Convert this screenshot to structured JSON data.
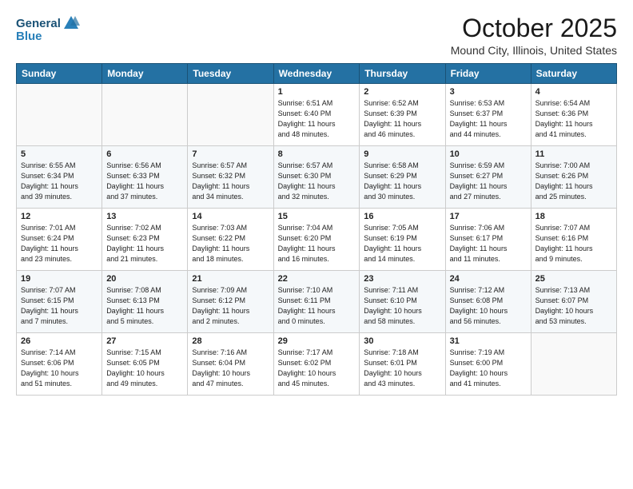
{
  "header": {
    "logo_general": "General",
    "logo_blue": "Blue",
    "month": "October 2025",
    "location": "Mound City, Illinois, United States"
  },
  "weekdays": [
    "Sunday",
    "Monday",
    "Tuesday",
    "Wednesday",
    "Thursday",
    "Friday",
    "Saturday"
  ],
  "weeks": [
    [
      {
        "day": "",
        "info": ""
      },
      {
        "day": "",
        "info": ""
      },
      {
        "day": "",
        "info": ""
      },
      {
        "day": "1",
        "info": "Sunrise: 6:51 AM\nSunset: 6:40 PM\nDaylight: 11 hours\nand 48 minutes."
      },
      {
        "day": "2",
        "info": "Sunrise: 6:52 AM\nSunset: 6:39 PM\nDaylight: 11 hours\nand 46 minutes."
      },
      {
        "day": "3",
        "info": "Sunrise: 6:53 AM\nSunset: 6:37 PM\nDaylight: 11 hours\nand 44 minutes."
      },
      {
        "day": "4",
        "info": "Sunrise: 6:54 AM\nSunset: 6:36 PM\nDaylight: 11 hours\nand 41 minutes."
      }
    ],
    [
      {
        "day": "5",
        "info": "Sunrise: 6:55 AM\nSunset: 6:34 PM\nDaylight: 11 hours\nand 39 minutes."
      },
      {
        "day": "6",
        "info": "Sunrise: 6:56 AM\nSunset: 6:33 PM\nDaylight: 11 hours\nand 37 minutes."
      },
      {
        "day": "7",
        "info": "Sunrise: 6:57 AM\nSunset: 6:32 PM\nDaylight: 11 hours\nand 34 minutes."
      },
      {
        "day": "8",
        "info": "Sunrise: 6:57 AM\nSunset: 6:30 PM\nDaylight: 11 hours\nand 32 minutes."
      },
      {
        "day": "9",
        "info": "Sunrise: 6:58 AM\nSunset: 6:29 PM\nDaylight: 11 hours\nand 30 minutes."
      },
      {
        "day": "10",
        "info": "Sunrise: 6:59 AM\nSunset: 6:27 PM\nDaylight: 11 hours\nand 27 minutes."
      },
      {
        "day": "11",
        "info": "Sunrise: 7:00 AM\nSunset: 6:26 PM\nDaylight: 11 hours\nand 25 minutes."
      }
    ],
    [
      {
        "day": "12",
        "info": "Sunrise: 7:01 AM\nSunset: 6:24 PM\nDaylight: 11 hours\nand 23 minutes."
      },
      {
        "day": "13",
        "info": "Sunrise: 7:02 AM\nSunset: 6:23 PM\nDaylight: 11 hours\nand 21 minutes."
      },
      {
        "day": "14",
        "info": "Sunrise: 7:03 AM\nSunset: 6:22 PM\nDaylight: 11 hours\nand 18 minutes."
      },
      {
        "day": "15",
        "info": "Sunrise: 7:04 AM\nSunset: 6:20 PM\nDaylight: 11 hours\nand 16 minutes."
      },
      {
        "day": "16",
        "info": "Sunrise: 7:05 AM\nSunset: 6:19 PM\nDaylight: 11 hours\nand 14 minutes."
      },
      {
        "day": "17",
        "info": "Sunrise: 7:06 AM\nSunset: 6:17 PM\nDaylight: 11 hours\nand 11 minutes."
      },
      {
        "day": "18",
        "info": "Sunrise: 7:07 AM\nSunset: 6:16 PM\nDaylight: 11 hours\nand 9 minutes."
      }
    ],
    [
      {
        "day": "19",
        "info": "Sunrise: 7:07 AM\nSunset: 6:15 PM\nDaylight: 11 hours\nand 7 minutes."
      },
      {
        "day": "20",
        "info": "Sunrise: 7:08 AM\nSunset: 6:13 PM\nDaylight: 11 hours\nand 5 minutes."
      },
      {
        "day": "21",
        "info": "Sunrise: 7:09 AM\nSunset: 6:12 PM\nDaylight: 11 hours\nand 2 minutes."
      },
      {
        "day": "22",
        "info": "Sunrise: 7:10 AM\nSunset: 6:11 PM\nDaylight: 11 hours\nand 0 minutes."
      },
      {
        "day": "23",
        "info": "Sunrise: 7:11 AM\nSunset: 6:10 PM\nDaylight: 10 hours\nand 58 minutes."
      },
      {
        "day": "24",
        "info": "Sunrise: 7:12 AM\nSunset: 6:08 PM\nDaylight: 10 hours\nand 56 minutes."
      },
      {
        "day": "25",
        "info": "Sunrise: 7:13 AM\nSunset: 6:07 PM\nDaylight: 10 hours\nand 53 minutes."
      }
    ],
    [
      {
        "day": "26",
        "info": "Sunrise: 7:14 AM\nSunset: 6:06 PM\nDaylight: 10 hours\nand 51 minutes."
      },
      {
        "day": "27",
        "info": "Sunrise: 7:15 AM\nSunset: 6:05 PM\nDaylight: 10 hours\nand 49 minutes."
      },
      {
        "day": "28",
        "info": "Sunrise: 7:16 AM\nSunset: 6:04 PM\nDaylight: 10 hours\nand 47 minutes."
      },
      {
        "day": "29",
        "info": "Sunrise: 7:17 AM\nSunset: 6:02 PM\nDaylight: 10 hours\nand 45 minutes."
      },
      {
        "day": "30",
        "info": "Sunrise: 7:18 AM\nSunset: 6:01 PM\nDaylight: 10 hours\nand 43 minutes."
      },
      {
        "day": "31",
        "info": "Sunrise: 7:19 AM\nSunset: 6:00 PM\nDaylight: 10 hours\nand 41 minutes."
      },
      {
        "day": "",
        "info": ""
      }
    ]
  ]
}
